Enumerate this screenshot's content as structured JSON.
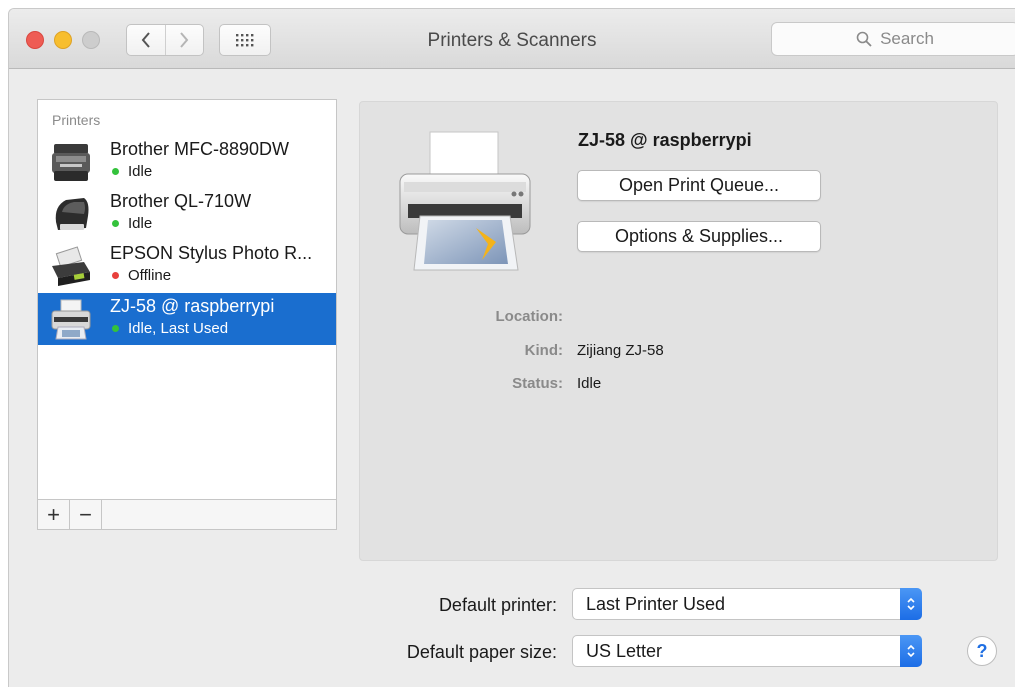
{
  "window": {
    "title": "Printers & Scanners"
  },
  "toolbar": {
    "search_placeholder": "Search"
  },
  "sidebar": {
    "header": "Printers",
    "printers": [
      {
        "name": "Brother MFC-8890DW",
        "status": "Idle",
        "status_color": "#34c23c",
        "icon": "multifunction-printer-icon"
      },
      {
        "name": "Brother QL-710W",
        "status": "Idle",
        "status_color": "#34c23c",
        "icon": "label-printer-icon"
      },
      {
        "name": "EPSON Stylus Photo R...",
        "status": "Offline",
        "status_color": "#e8403c",
        "icon": "photo-printer-icon"
      },
      {
        "name": "ZJ-58 @ raspberrypi",
        "status": "Idle, Last Used",
        "status_color": "#34c23c",
        "icon": "receipt-printer-icon",
        "selected": true
      }
    ],
    "add_label": "+",
    "remove_label": "−"
  },
  "detail": {
    "printer_name": "ZJ-58 @ raspberrypi",
    "open_queue_label": "Open Print Queue...",
    "options_label": "Options & Supplies...",
    "location_label": "Location:",
    "location_value": "",
    "kind_label": "Kind:",
    "kind_value": "Zijiang ZJ-58",
    "status_label": "Status:",
    "status_value": "Idle"
  },
  "defaults": {
    "default_printer_label": "Default printer:",
    "default_printer_value": "Last Printer Used",
    "paper_size_label": "Default paper size:",
    "paper_size_value": "US Letter"
  },
  "help_label": "?",
  "colors": {
    "selection": "#1a6ecf",
    "accent": "#1c6de6"
  }
}
